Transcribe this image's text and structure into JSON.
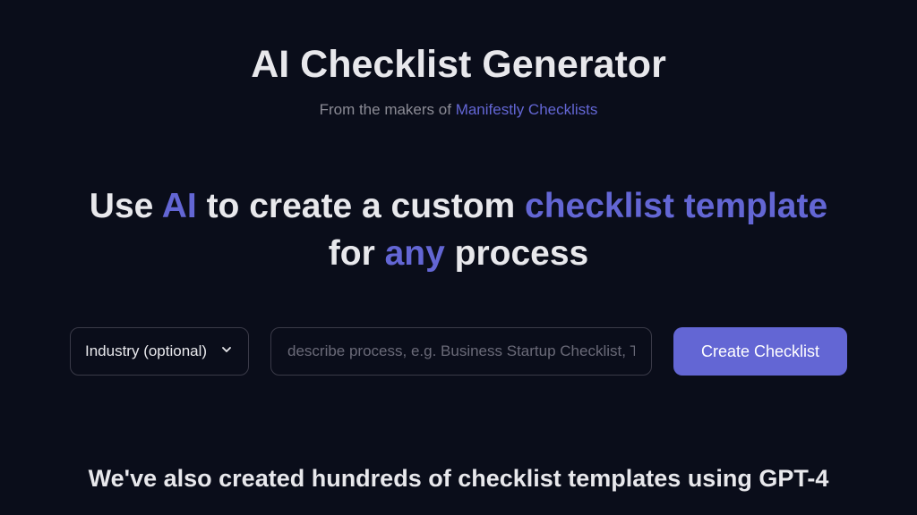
{
  "title": "AI Checklist Generator",
  "subtitle": {
    "prefix": "From the makers of ",
    "link_text": "Manifestly Checklists"
  },
  "headline": {
    "part1": "Use ",
    "accent1": "AI",
    "part2": " to create a custom ",
    "accent2": "checklist template",
    "part3": " for ",
    "accent3": "any",
    "part4": " process"
  },
  "form": {
    "industry_label": "Industry (optional)",
    "process_placeholder": "describe process, e.g. Business Startup Checklist, Tra",
    "button_label": "Create Checklist"
  },
  "footer": "We've also created hundreds of checklist templates using GPT-4"
}
